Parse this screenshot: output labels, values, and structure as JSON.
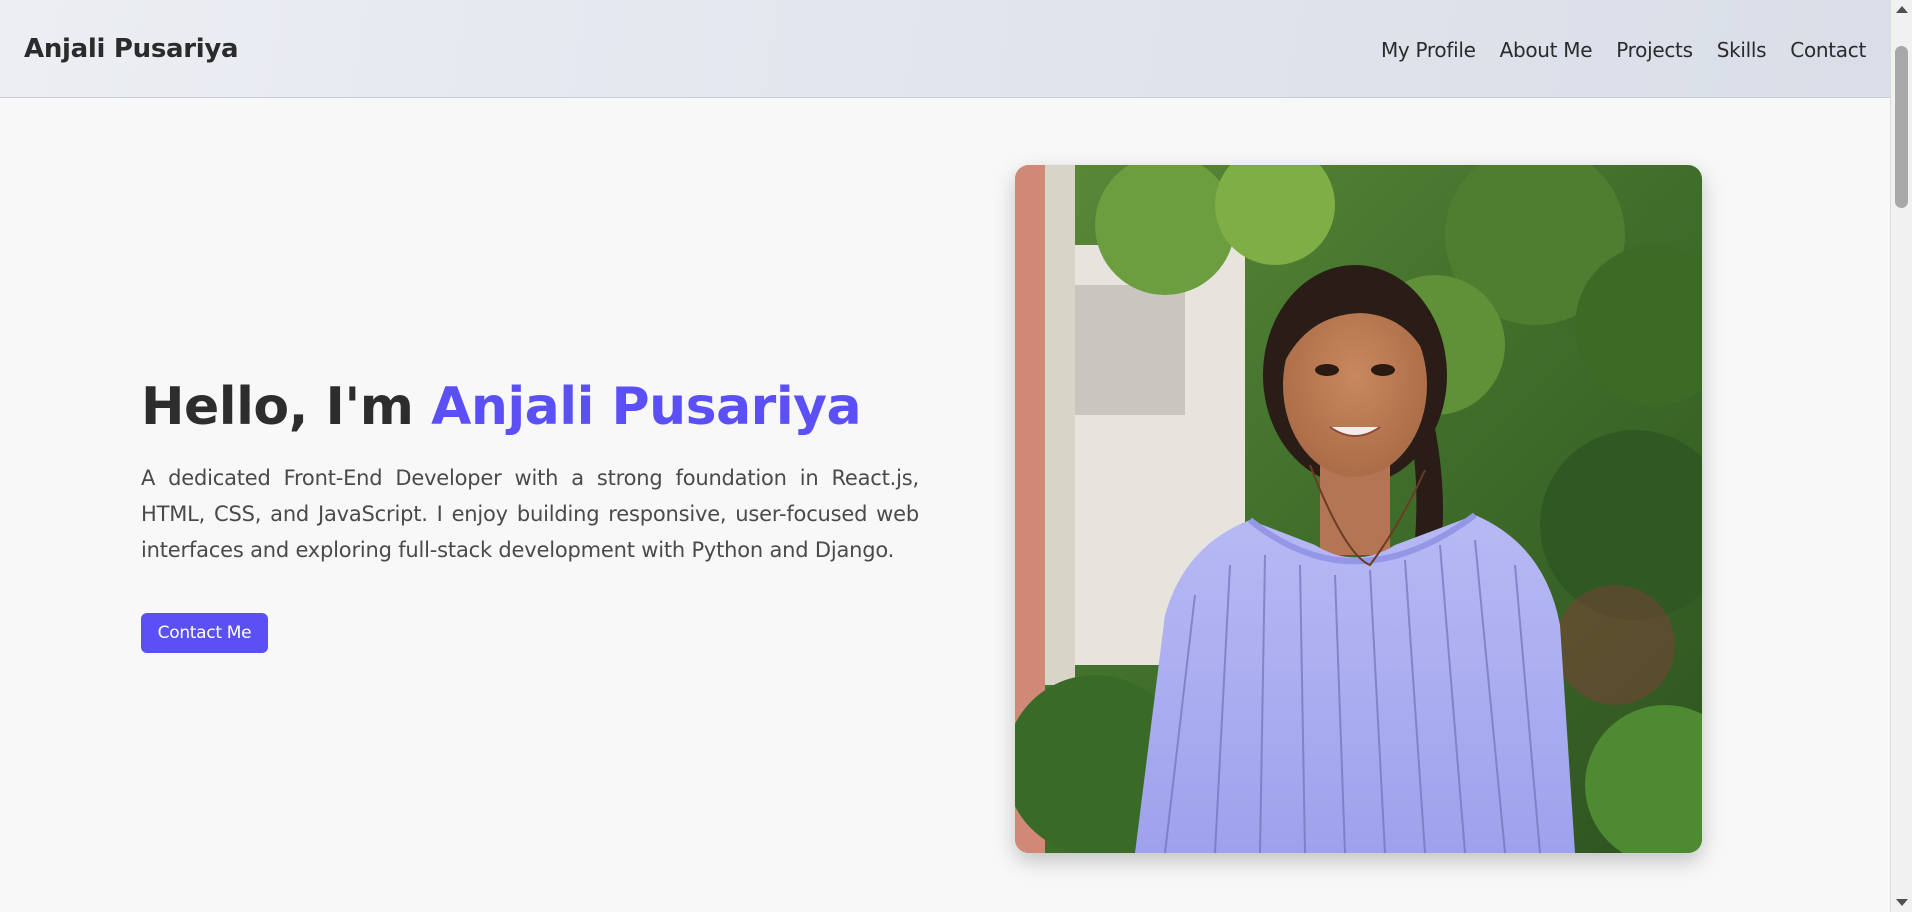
{
  "header": {
    "brand": "Anjali Pusariya",
    "nav": [
      {
        "label": "My Profile"
      },
      {
        "label": "About Me"
      },
      {
        "label": "Projects"
      },
      {
        "label": "Skills"
      },
      {
        "label": "Contact"
      }
    ]
  },
  "hero": {
    "greeting": "Hello, I'm",
    "name": "Anjali Pusariya",
    "description": "A dedicated Front-End Developer with a strong foundation in React.js, HTML, CSS, and JavaScript. I enjoy building responsive, user-focused web interfaces and exploring full-stack development with Python and Django.",
    "cta_label": "Contact Me"
  },
  "colors": {
    "accent": "#5b50f5",
    "text": "#2d2d2d",
    "background": "#f8f8f8"
  },
  "icons": {
    "scroll_up": "scroll-up-arrow-icon",
    "scroll_down": "scroll-down-arrow-icon"
  }
}
